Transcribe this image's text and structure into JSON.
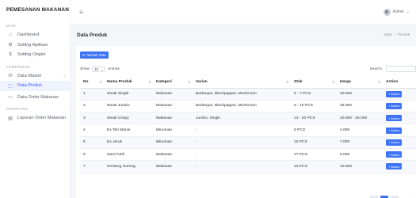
{
  "brand": "PEMESANAN MAKANAN",
  "sidebar": {
    "sections": [
      {
        "label": "MAIN",
        "items": [
          {
            "icon": "dashboard-icon",
            "glyph": "⌂",
            "label": "Dashboard",
            "active": false
          },
          {
            "icon": "gear-icon",
            "glyph": "⚙",
            "label": "Setting Aplikasi",
            "active": false
          },
          {
            "icon": "dollar-icon",
            "glyph": "$",
            "label": "Setting Ongkir",
            "active": false
          }
        ]
      },
      {
        "label": "COMPONENT",
        "items": [
          {
            "icon": "database-icon",
            "glyph": "⛁",
            "label": "Data Master",
            "active": false,
            "chevron": "›"
          },
          {
            "icon": "box-icon",
            "glyph": "⬚",
            "label": "Data Produk",
            "active": true
          }
        ]
      },
      {
        "label": "",
        "items": [
          {
            "icon": "monitor-icon",
            "glyph": "▭",
            "label": "Data Order Makanan",
            "active": false
          }
        ]
      },
      {
        "label": "REPORTING",
        "items": [
          {
            "icon": "document-icon",
            "glyph": "▤",
            "label": "Laporan Order Makanan",
            "active": false
          }
        ]
      }
    ]
  },
  "header": {
    "menu_icon": "hamburger-icon",
    "user_label": "Admin",
    "user_caret": "⌄"
  },
  "page": {
    "title": "Data Produk",
    "breadcrumb": [
      "Data",
      "Produk"
    ],
    "breadcrumb_sep": "/",
    "add_button": "⊕ Tambah Data",
    "show_label": "Show",
    "show_value": "10",
    "entries_label": "entries",
    "search_label": "Search:",
    "colors": {
      "accent": "#3d73f5"
    }
  },
  "table": {
    "columns": [
      "No",
      "Nama Produk",
      "Kategori",
      "Varian",
      "Stok",
      "Harga",
      "Action"
    ],
    "rows": [
      [
        "1",
        "Steak Single",
        "Makanan",
        "Barbeque, Blackpapper, Mushroom",
        "5 - 7 PCS",
        "20.000"
      ],
      [
        "2",
        "Steak Jumbo",
        "Makanan",
        "Barbeque, Blackpapper, Mushroom",
        "5 - 10 PCS",
        "25.000"
      ],
      [
        "3",
        "Steak Crispy",
        "Makanan",
        "Jumbo, Single",
        "13 - 20 PCS",
        "20.000 - 25.000"
      ],
      [
        "4",
        "Es Teh Manis",
        "Minuman",
        "-",
        "8 PCS",
        "4.000"
      ],
      [
        "5",
        "Es Jeruk",
        "Minuman",
        "-",
        "15 PCS",
        "7.000"
      ],
      [
        "6",
        "Nasi Putih",
        "Makanan",
        "-",
        "27 PCS",
        "5.000"
      ],
      [
        "7",
        "Kentang Goreng",
        "Makanan",
        "-",
        "23 PCS",
        "10.000"
      ]
    ],
    "action_label": "+ Action"
  }
}
